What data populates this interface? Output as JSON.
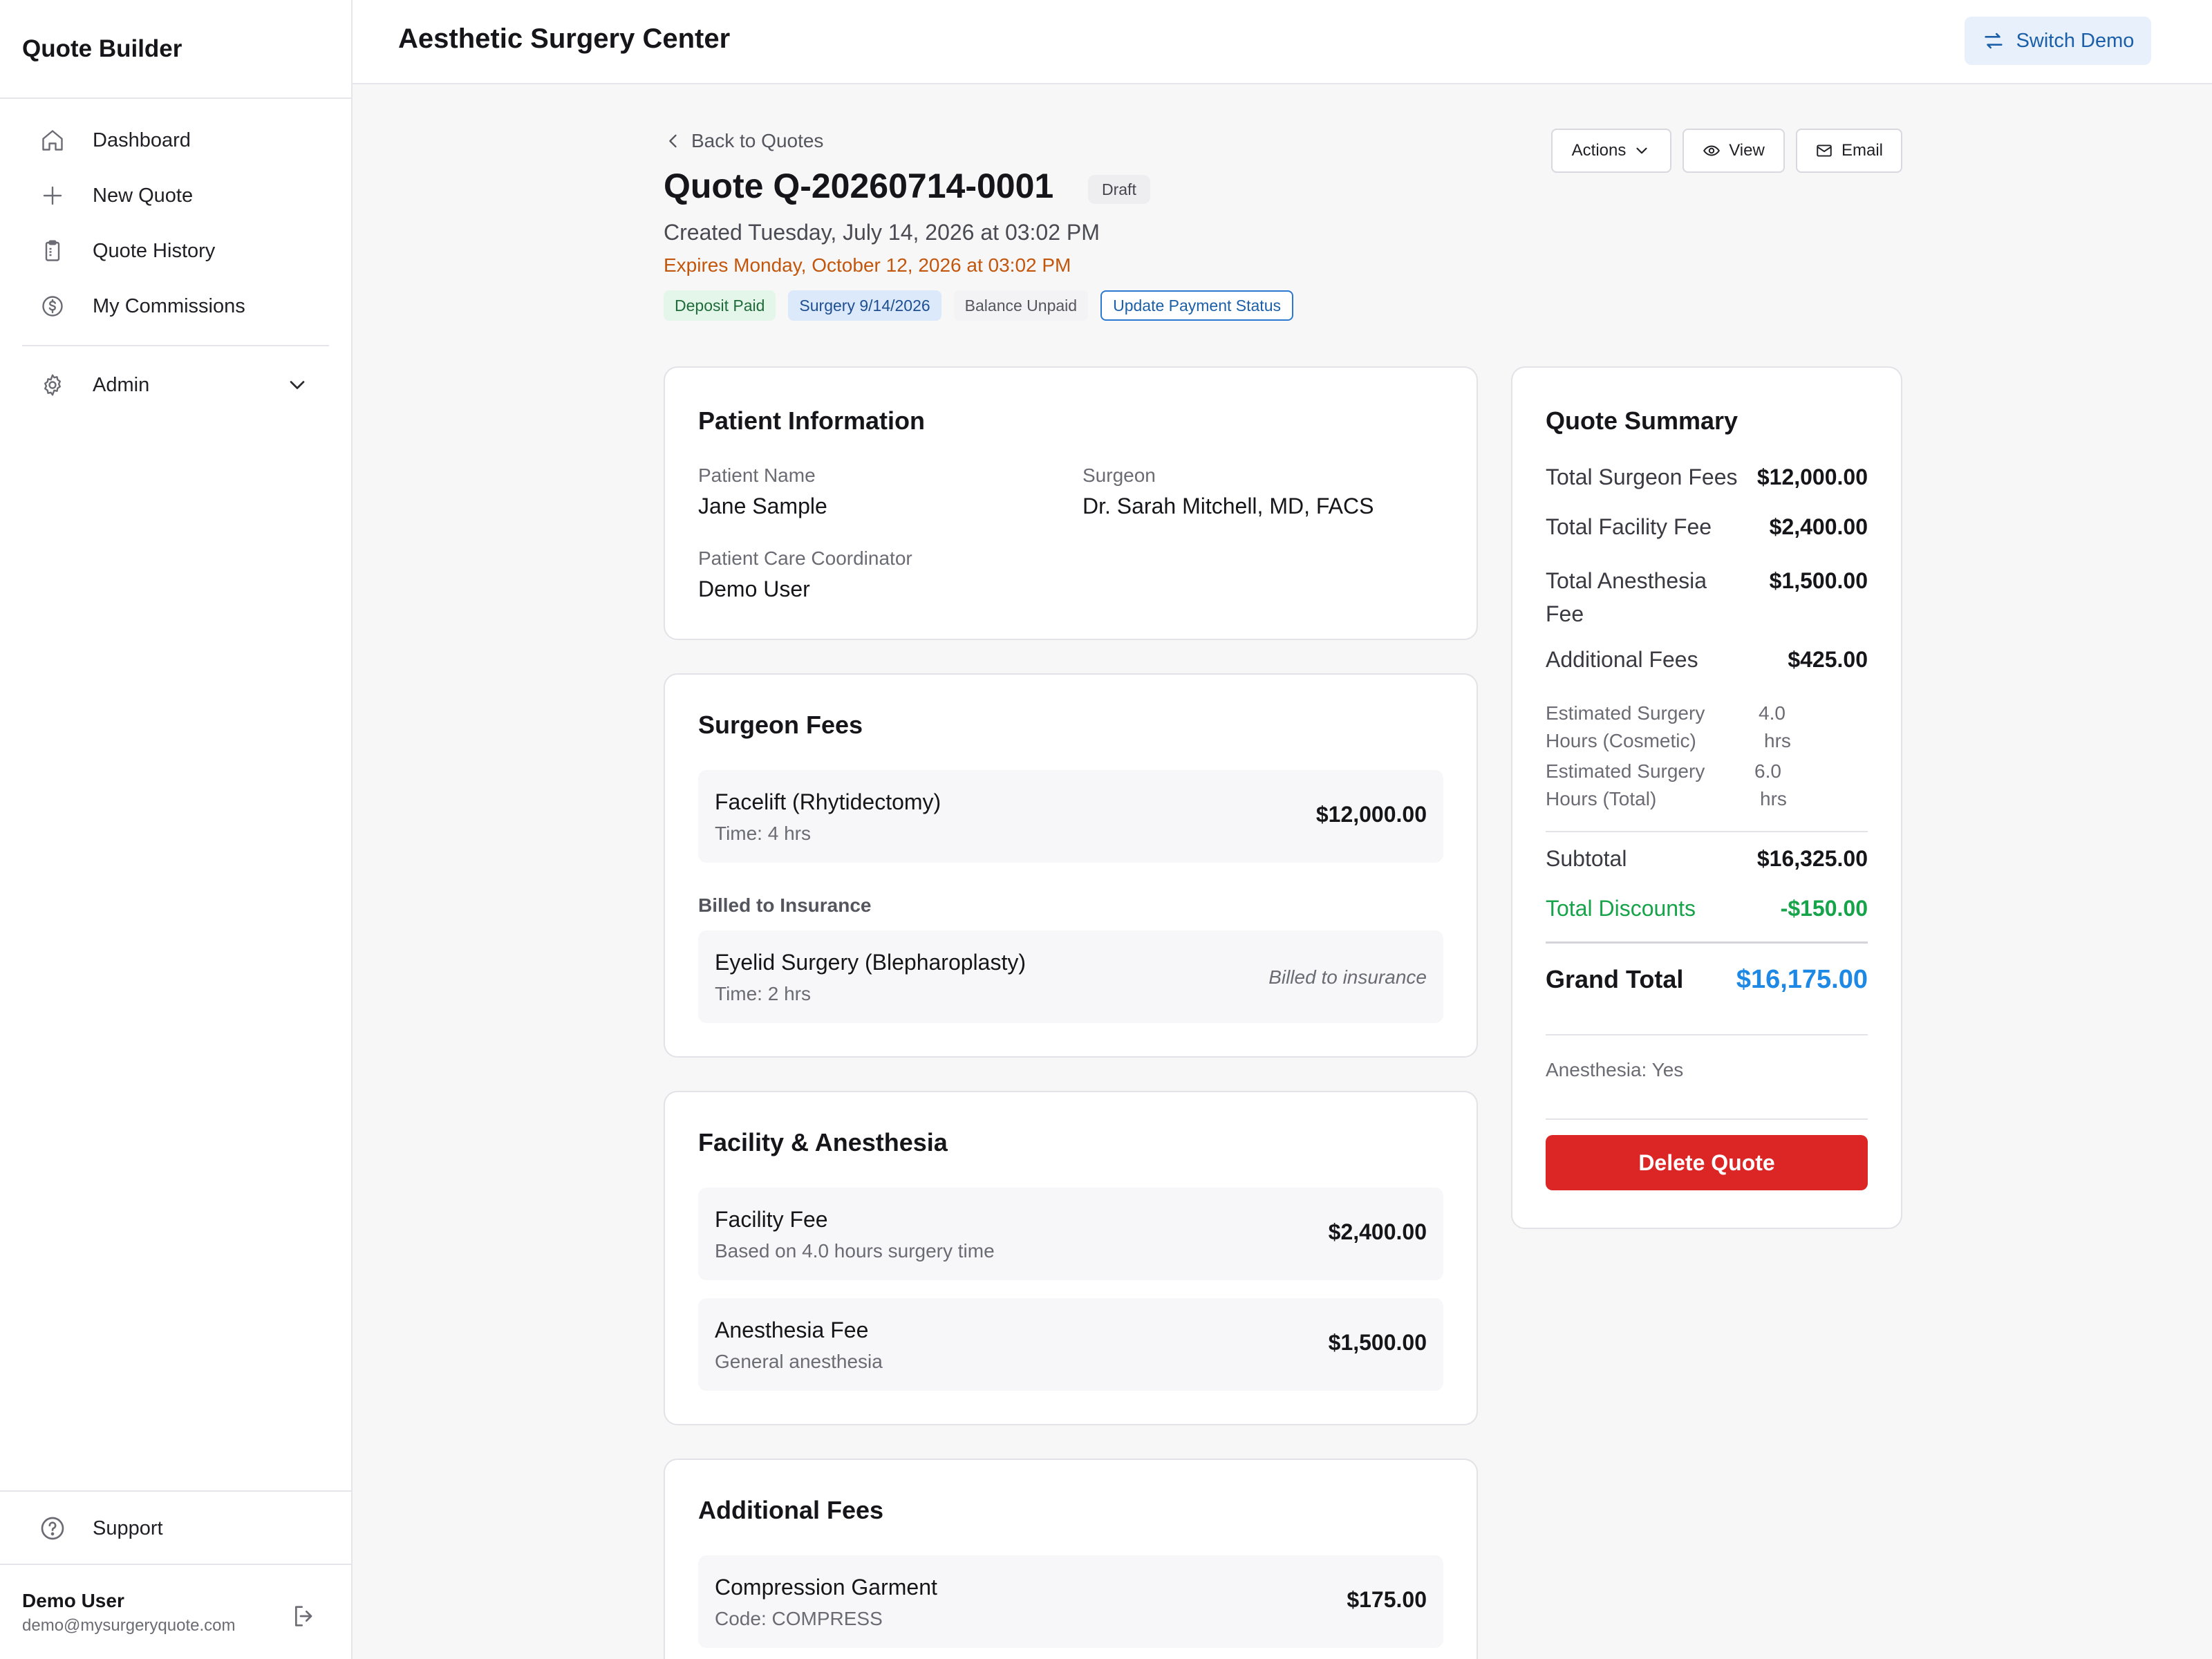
{
  "app": {
    "title": "Quote Builder"
  },
  "sidebar": {
    "items": [
      {
        "label": "Dashboard",
        "icon": "home-icon"
      },
      {
        "label": "New Quote",
        "icon": "plus-icon"
      },
      {
        "label": "Quote History",
        "icon": "clipboard-icon"
      },
      {
        "label": "My Commissions",
        "icon": "dollar-circle-icon"
      }
    ],
    "admin": {
      "label": "Admin",
      "icon": "gear-icon"
    },
    "support": {
      "label": "Support",
      "icon": "help-circle-icon"
    },
    "user": {
      "name": "Demo User",
      "email": "demo@mysurgeryquote.com"
    }
  },
  "topbar": {
    "org": "Aesthetic Surgery Center",
    "switch_label": "Switch Demo"
  },
  "quote": {
    "back_label": "Back to Quotes",
    "title": "Quote Q-20260714-0001",
    "status": "Draft",
    "created": "Created Tuesday, July 14, 2026 at 03:02 PM",
    "expires": "Expires Monday, October 12, 2026 at 03:02 PM",
    "badges": {
      "deposit": "Deposit Paid",
      "surgery": "Surgery 9/14/2026",
      "balance": "Balance Unpaid",
      "update": "Update Payment Status"
    },
    "actions": {
      "actions_label": "Actions",
      "view_label": "View",
      "email_label": "Email"
    }
  },
  "patient": {
    "title": "Patient Information",
    "name_label": "Patient Name",
    "name": "Jane Sample",
    "surgeon_label": "Surgeon",
    "surgeon": "Dr. Sarah Mitchell, MD, FACS",
    "coordinator_label": "Patient Care Coordinator",
    "coordinator": "Demo User"
  },
  "surgeon_fees": {
    "title": "Surgeon Fees",
    "items": [
      {
        "name": "Facelift (Rhytidectomy)",
        "sub": "Time: 4 hrs",
        "amount": "$12,000.00"
      }
    ],
    "insurance_label": "Billed to Insurance",
    "insurance_items": [
      {
        "name": "Eyelid Surgery (Blepharoplasty)",
        "sub": "Time: 2 hrs",
        "note": "Billed to insurance"
      }
    ]
  },
  "facility": {
    "title": "Facility & Anesthesia",
    "items": [
      {
        "name": "Facility Fee",
        "sub": "Based on 4.0 hours surgery time",
        "amount": "$2,400.00"
      },
      {
        "name": "Anesthesia Fee",
        "sub": "General anesthesia",
        "amount": "$1,500.00"
      }
    ]
  },
  "additional": {
    "title": "Additional Fees",
    "items": [
      {
        "name": "Compression Garment",
        "sub": "Code: COMPRESS",
        "amount": "$175.00"
      }
    ]
  },
  "summary": {
    "title": "Quote Summary",
    "surgeon_fees_label": "Total Surgeon Fees",
    "surgeon_fees": "$12,000.00",
    "facility_label": "Total Facility Fee",
    "facility": "$2,400.00",
    "anesthesia_label_1": "Total Anesthesia",
    "anesthesia_label_2": "Fee",
    "anesthesia": "$1,500.00",
    "additional_label": "Additional Fees",
    "additional": "$425.00",
    "hours_cosmetic_label_1": "Estimated Surgery",
    "hours_cosmetic_label_2": "Hours (Cosmetic)",
    "hours_cosmetic_value": "4.0",
    "hours_cosmetic_unit": "hrs",
    "hours_total_label_1": "Estimated Surgery",
    "hours_total_label_2": "Hours (Total)",
    "hours_total_value": "6.0",
    "hours_total_unit": "hrs",
    "subtotal_label": "Subtotal",
    "subtotal": "$16,325.00",
    "discounts_label": "Total Discounts",
    "discounts": "-$150.00",
    "grand_total_label": "Grand Total",
    "grand_total": "$16,175.00",
    "anesthesia_note": "Anesthesia: Yes",
    "delete_label": "Delete Quote"
  },
  "colors": {
    "accent": "#2b78d0",
    "grand_total": "#1e88e5",
    "discount": "#16a34a",
    "expires": "#c2560c",
    "danger": "#dc2626"
  }
}
